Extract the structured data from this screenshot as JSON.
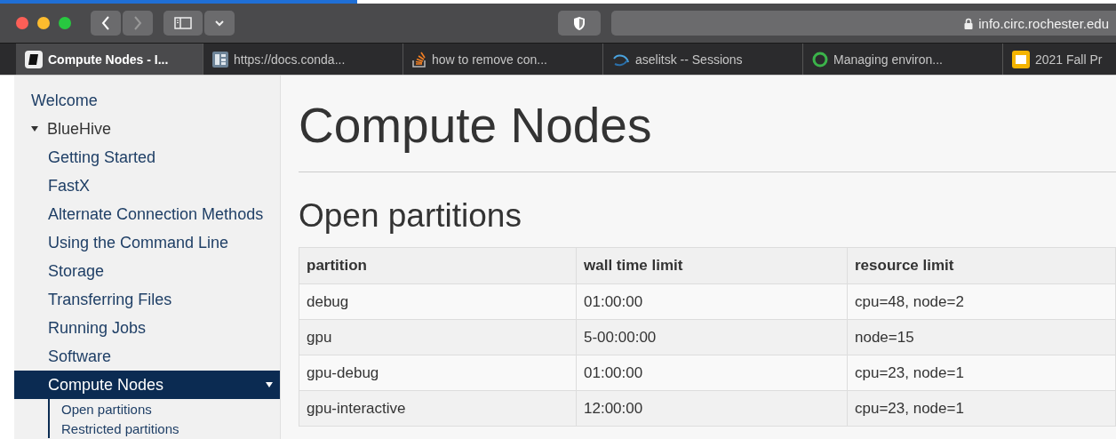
{
  "browser": {
    "loading": {
      "level": 0.32
    },
    "address": "info.circ.rochester.edu",
    "tabs": [
      {
        "label": "Compute Nodes - I...",
        "selected": true
      },
      {
        "label": "https://docs.conda...",
        "selected": false
      },
      {
        "label": "how to remove con...",
        "selected": false
      },
      {
        "label": "aselitsk -- Sessions",
        "selected": false
      },
      {
        "label": "Managing environ...",
        "selected": false
      },
      {
        "label": "2021 Fall Pr",
        "selected": false
      }
    ]
  },
  "sidebar": {
    "items": [
      {
        "label": "Welcome",
        "selected": false
      },
      {
        "label": "BlueHive",
        "selected": false,
        "expanded": true,
        "children": [
          {
            "label": "Getting Started",
            "selected": false
          },
          {
            "label": "FastX",
            "selected": false
          },
          {
            "label": "Alternate Connection Methods",
            "selected": false
          },
          {
            "label": "Using the Command Line",
            "selected": false
          },
          {
            "label": "Storage",
            "selected": false
          },
          {
            "label": "Transferring Files",
            "selected": false
          },
          {
            "label": "Running Jobs",
            "selected": false
          },
          {
            "label": "Software",
            "selected": false
          },
          {
            "label": "Compute Nodes",
            "selected": true,
            "expanded": true,
            "children": [
              {
                "label": "Open partitions",
                "selected": false
              },
              {
                "label": "Restricted partitions",
                "selected": false
              }
            ]
          }
        ]
      }
    ]
  },
  "page": {
    "title": "Compute Nodes",
    "section": "Open partitions",
    "table": {
      "columns": [
        "partition",
        "wall time limit",
        "resource limit"
      ],
      "rows": [
        [
          "debug",
          "01:00:00",
          "cpu=48, node=2"
        ],
        [
          "gpu",
          "5-00:00:00",
          "node=15"
        ],
        [
          "gpu-debug",
          "01:00:00",
          "cpu=23, node=1"
        ],
        [
          "gpu-interactive",
          "12:00:00",
          "cpu=23, node=1"
        ]
      ]
    }
  }
}
